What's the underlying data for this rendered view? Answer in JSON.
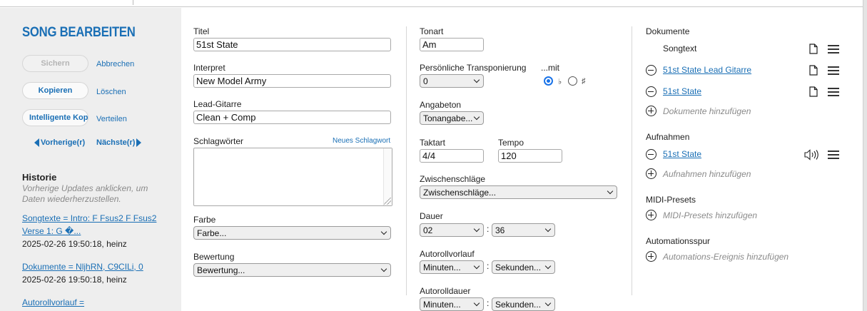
{
  "sidebar": {
    "title": "SONG BEARBEITEN",
    "save_label": "Sichern",
    "cancel_label": "Abbrechen",
    "copy_label": "Kopieren",
    "delete_label": "Löschen",
    "smart_copy_label": "Intelligente Kopie",
    "share_label": "Verteilen",
    "prev_label": "Vorherige(r)",
    "next_label": "Nächste(r)",
    "history": {
      "title": "Historie",
      "description": "Vorherige Updates anklicken, um Daten wiederherzustellen.",
      "entries": [
        {
          "line1": "Songtexte = Intro: F Fsus2  F Fsus2",
          "line2": "Verse 1: G            �...",
          "date": "2025-02-26 19:50:18, heinz"
        },
        {
          "line1": "Dokumente = NljhRN, C9CILi, 0",
          "date": "2025-02-26 19:50:18, heinz"
        },
        {
          "line1": "Autorollvorlauf ="
        }
      ]
    }
  },
  "form": {
    "title_label": "Titel",
    "title_value": "51st State",
    "artist_label": "Interpret",
    "artist_value": "New Model Army",
    "lead_label": "Lead-Gitarre",
    "lead_value": "Clean + Comp",
    "tags_label": "Schlagwörter",
    "new_tag_link": "Neues Schlagwort",
    "color_label": "Farbe",
    "color_value": "Farbe...",
    "rating_label": "Bewertung",
    "rating_value": "Bewertung..."
  },
  "music": {
    "key_label": "Tonart",
    "key_value": "Am",
    "transpose_label": "Persönliche Transponierung",
    "transpose_value": "0",
    "with_label": "...mit",
    "flat_symbol": "♭",
    "sharp_symbol": "♯",
    "accidental_selected": "flat",
    "pitch_label": "Angabeton",
    "pitch_value": "Tonangabe...",
    "time_sig_label": "Taktart",
    "time_sig_value": "4/4",
    "tempo_label": "Tempo",
    "tempo_value": "120",
    "intermediate_label": "Zwischenschläge",
    "intermediate_value": "Zwischenschläge...",
    "duration_label": "Dauer",
    "duration_min": "02",
    "duration_sec": "36",
    "colon": ":",
    "autoscroll_pre_label": "Autorollvorlauf",
    "autoscroll_pre_min": "Minuten...",
    "autoscroll_pre_sec": "Sekunden...",
    "autoscroll_dur_label": "Autorolldauer",
    "autoscroll_dur_min": "Minuten...",
    "autoscroll_dur_sec": "Sekunden..."
  },
  "documents": {
    "title": "Dokumente",
    "items": [
      {
        "name": "Songtext"
      },
      {
        "name": "51st State Lead Gitarre"
      },
      {
        "name": "51st State"
      }
    ],
    "add_label": "Dokumente hinzufügen"
  },
  "recordings": {
    "title": "Aufnahmen",
    "items": [
      {
        "name": "51st State"
      }
    ],
    "add_label": "Aufnahmen hinzufügen"
  },
  "midi": {
    "title": "MIDI-Presets",
    "add_label": "MIDI-Presets hinzufügen"
  },
  "automation": {
    "title": "Automationsspur",
    "add_label": "Automations-Ereignis hinzufügen"
  },
  "colors": {
    "accent": "#1a6fb5",
    "radio_selected": "#1a73e8",
    "sidebar_bg": "#eeeeee"
  }
}
